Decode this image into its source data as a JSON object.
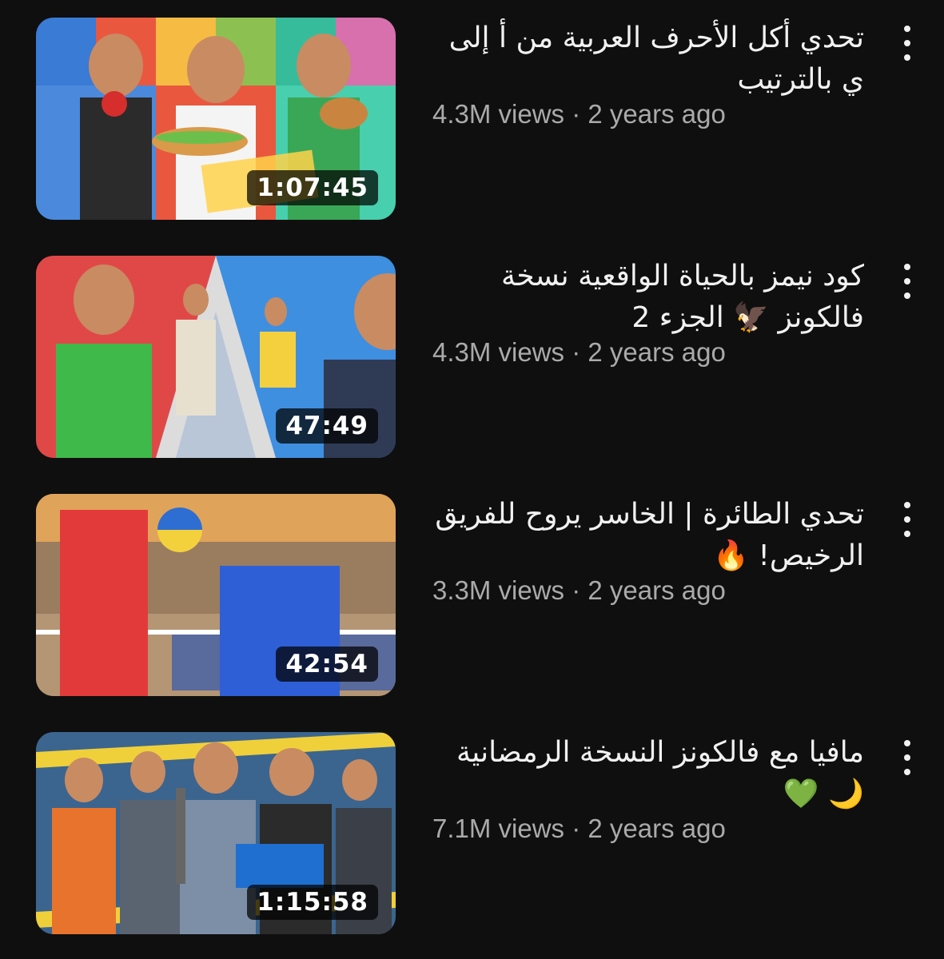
{
  "videos": [
    {
      "title": "تحدي أكل الأحرف العربية من أ إلى ي بالترتيب",
      "views": "4.3M views",
      "age": "2 years ago",
      "duration": "1:07:45",
      "menu_icon": "more-vert-icon"
    },
    {
      "title": "كود نيمز بالحياة الواقعية نسخة فالكونز 🦅 الجزء 2",
      "views": "4.3M views",
      "age": "2 years ago",
      "duration": "47:49",
      "menu_icon": "more-vert-icon"
    },
    {
      "title": "تحدي الطائرة | الخاسر يروح للفريق الرخيص! 🔥",
      "views": "3.3M views",
      "age": "2 years ago",
      "duration": "42:54",
      "menu_icon": "more-vert-icon"
    },
    {
      "title": "مافيا مع فالكونز النسخة الرمضانية 🌙 💚",
      "views": "7.1M views",
      "age": "2 years ago",
      "duration": "1:15:58",
      "menu_icon": "more-vert-icon"
    }
  ],
  "stats_separator": " · ",
  "colors": {
    "background": "#0f0f0f",
    "title": "#f1f1f1",
    "secondary": "#aaaaaa"
  }
}
